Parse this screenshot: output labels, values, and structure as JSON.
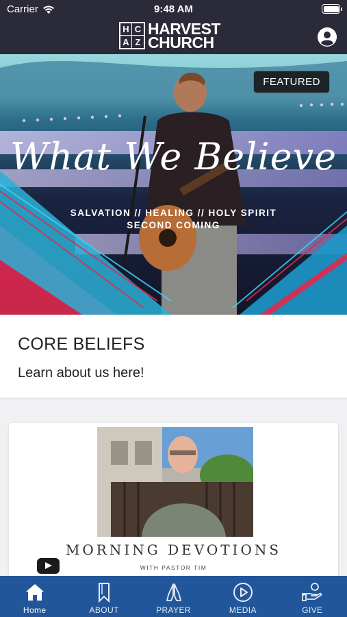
{
  "status_bar": {
    "carrier": "Carrier",
    "time": "9:48 AM"
  },
  "header": {
    "logo_letters": [
      "H",
      "C",
      "A",
      "Z"
    ],
    "logo_line1": "HARVEST",
    "logo_line2": "CHURCH",
    "profile_icon": "user-circle-icon"
  },
  "featured": {
    "badge": "FEATURED",
    "title": "What We Believe",
    "subtitle_line1": "SALVATION // HEALING // HOLY SPIRIT",
    "subtitle_line2": "SECOND COMING"
  },
  "core_beliefs": {
    "title": "CORE BELIEFS",
    "subtitle": "Learn about us here!"
  },
  "media_card": {
    "title": "MORNING DEVOTIONS",
    "subtitle": "WITH PASTOR TIM",
    "video_icon": "youtube-play-icon"
  },
  "tabs": [
    {
      "label": "Home",
      "icon": "home-icon",
      "active": true
    },
    {
      "label": "ABOUT",
      "icon": "bookmark-icon",
      "active": false
    },
    {
      "label": "PRAYER",
      "icon": "praying-hands-icon",
      "active": false
    },
    {
      "label": "MEDIA",
      "icon": "play-circle-icon",
      "active": false
    },
    {
      "label": "GIVE",
      "icon": "give-hand-coin-icon",
      "active": false
    }
  ],
  "colors": {
    "header_bg": "#2b2a38",
    "tabbar_bg": "#22569a",
    "page_bg": "#f1f1f3"
  }
}
